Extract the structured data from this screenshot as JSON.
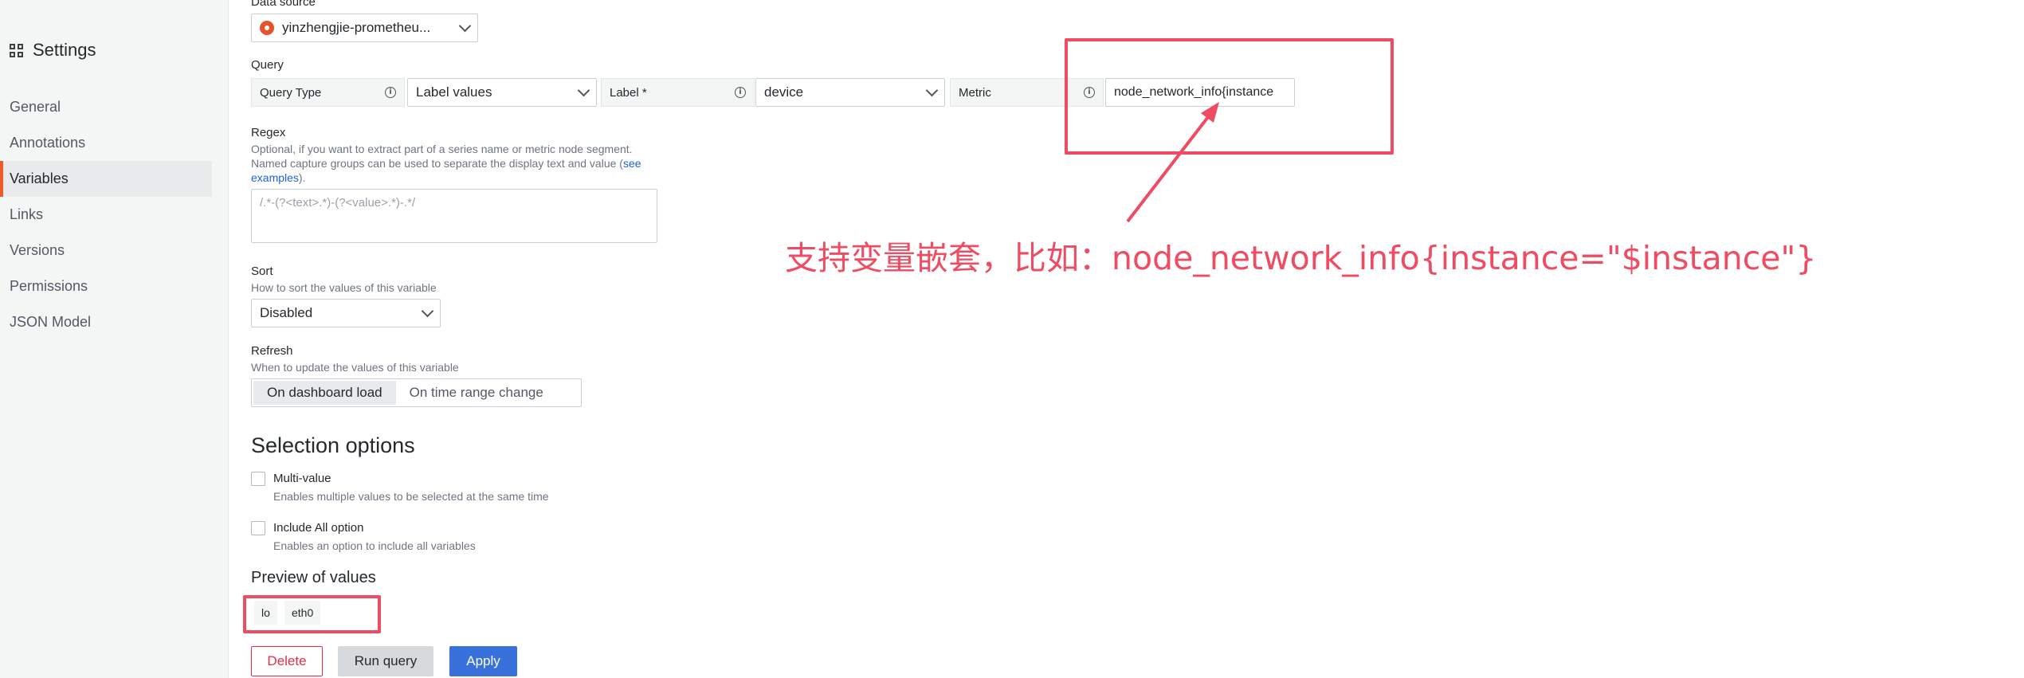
{
  "sidebar": {
    "title": "Settings",
    "items": [
      {
        "label": "General"
      },
      {
        "label": "Annotations"
      },
      {
        "label": "Variables"
      },
      {
        "label": "Links"
      },
      {
        "label": "Versions"
      },
      {
        "label": "Permissions"
      },
      {
        "label": "JSON Model"
      }
    ]
  },
  "datasource": {
    "label": "Data source",
    "value": "yinzhengjie-prometheu..."
  },
  "query": {
    "label": "Query",
    "query_type_label": "Query Type",
    "query_type_value": "Label values",
    "label_label": "Label *",
    "label_value": "device",
    "metric_label": "Metric",
    "metric_value": "node_network_info{instance"
  },
  "regex": {
    "label": "Regex",
    "desc1": "Optional, if you want to extract part of a series name or metric node segment.",
    "desc2": "Named capture groups can be used to separate the display text and value (",
    "link1": "see",
    "link2": "examples",
    "desc_end": ").",
    "placeholder": "/.*-(?<text>.*)-(?<value>.*)-.*/"
  },
  "sort": {
    "label": "Sort",
    "desc": "How to sort the values of this variable",
    "value": "Disabled"
  },
  "refresh": {
    "label": "Refresh",
    "desc": "When to update the values of this variable",
    "options": [
      "On dashboard load",
      "On time range change"
    ]
  },
  "selection": {
    "title": "Selection options",
    "multi_label": "Multi-value",
    "multi_desc": "Enables multiple values to be selected at the same time",
    "include_all_label": "Include All option",
    "include_all_desc": "Enables an option to include all variables"
  },
  "preview": {
    "title": "Preview of values",
    "values": [
      "lo",
      "eth0"
    ]
  },
  "buttons": {
    "delete": "Delete",
    "run_query": "Run query",
    "apply": "Apply"
  },
  "annotation": {
    "text": "支持变量嵌套，比如：node_network_info{instance=\"$instance\"}",
    "color": "#ef4b62"
  },
  "colors": {
    "accent": "#f05a28",
    "primary": "#3871dc",
    "danger": "#e02f44"
  }
}
